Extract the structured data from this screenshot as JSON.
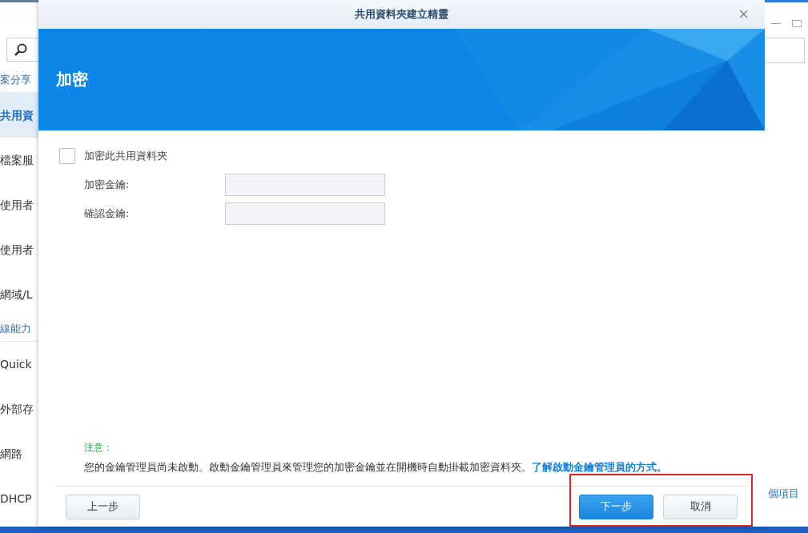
{
  "background_window": {
    "sidebar": [
      {
        "kind": "header",
        "label": "案分享"
      },
      {
        "kind": "item",
        "label": "共用資",
        "selected": true
      },
      {
        "kind": "item",
        "label": "檔案服",
        "selected": false
      },
      {
        "kind": "item",
        "label": "使用者",
        "selected": false
      },
      {
        "kind": "item",
        "label": "使用者",
        "selected": false
      },
      {
        "kind": "item",
        "label": "網域/L",
        "selected": false
      },
      {
        "kind": "header",
        "label": "線能力"
      },
      {
        "kind": "item",
        "label": "Quick",
        "selected": false
      },
      {
        "kind": "item",
        "label": "外部存",
        "selected": false
      },
      {
        "kind": "item",
        "label": "網路",
        "selected": false
      },
      {
        "kind": "item",
        "label": "DHCP",
        "selected": false
      }
    ],
    "item_count": "個項目"
  },
  "dialog": {
    "title": "共用資料夾建立精靈",
    "close": "×",
    "heading": "加密",
    "encrypt_checkbox": {
      "label": "加密此共用資料夾",
      "checked": false
    },
    "fields": [
      {
        "label": "加密金鑰:"
      },
      {
        "label": "確認金鑰:"
      }
    ],
    "note_title": "注意：",
    "note_text": "您的金鑰管理員尚未啟動。啟動金鑰管理員來管理您的加密金鑰並在開機時自動掛載加密資料夾。",
    "note_link": "了解啟動金鑰管理員的方式。",
    "buttons": [
      {
        "kind": "back",
        "label": "上一步"
      },
      {
        "kind": "primary",
        "label": "下一步"
      },
      {
        "kind": "cancel",
        "label": "取消"
      }
    ]
  }
}
